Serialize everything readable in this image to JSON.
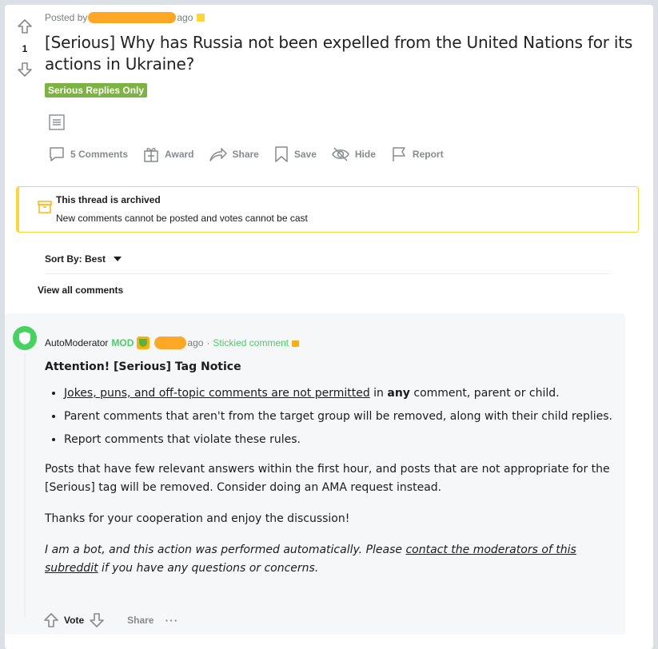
{
  "post": {
    "score": "1",
    "posted_by_prefix": "Posted by",
    "time_suffix": "ago",
    "title": "[Serious] Why has Russia not been expelled from the United Nations for its actions in Ukraine?",
    "flair": "Serious Replies Only",
    "flair_color": "#7cb342"
  },
  "actions": {
    "comments": "5 Comments",
    "award": "Award",
    "share": "Share",
    "save": "Save",
    "hide": "Hide",
    "report": "Report"
  },
  "archived": {
    "heading": "This thread is archived",
    "subtext": "New comments cannot be posted and votes cannot be cast",
    "accent_color": "#ffd635"
  },
  "sort": {
    "label": "Sort By: Best"
  },
  "view_all": "View all comments",
  "comment": {
    "author": "AutoModerator",
    "mod_tag": "MOD",
    "time_suffix": "ago",
    "separator": "·",
    "stickied": "Stickied comment",
    "heading": "Attention! [Serious] Tag Notice",
    "bullet1_link": "Jokes, puns, and off-topic comments are not permitted",
    "bullet1_mid": " in ",
    "bullet1_bold": "any",
    "bullet1_end": " comment, parent or child.",
    "bullet2": "Parent comments that aren't from the target group will be removed, along with their child replies.",
    "bullet3": "Report comments that violate these rules.",
    "para1": "Posts that have few relevant answers within the first hour, and posts that are not appropriate for the [Serious] tag will be removed. Consider doing an AMA request instead.",
    "para2": "Thanks for your cooperation and enjoy the discussion!",
    "bot_pre": "I am a bot, and this action was performed automatically. Please ",
    "bot_link": "contact the moderators of this subreddit",
    "bot_post": " if you have any questions or concerns.",
    "vote_label": "Vote",
    "share": "Share",
    "more": "···",
    "mod_color": "#46d160"
  }
}
